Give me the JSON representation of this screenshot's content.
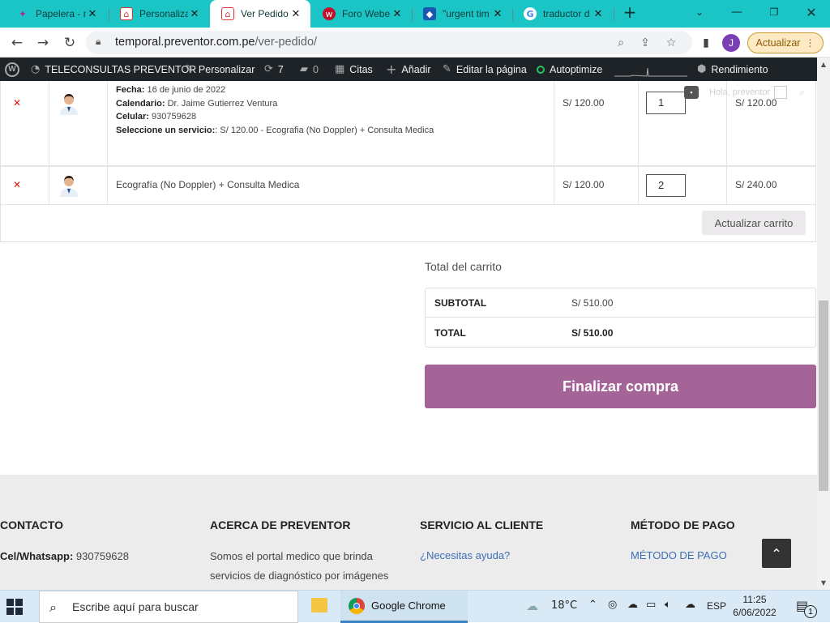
{
  "browser": {
    "tabs": [
      {
        "title": "Papelera - r",
        "fav_color": "#1bc5c5",
        "fav_glyph": "✦",
        "icon": "papelera-favicon"
      },
      {
        "title": "Personaliza",
        "fav_color": "#d33",
        "fav_glyph": "⌂",
        "icon": "preventor-favicon"
      },
      {
        "title": "Ver Pedido",
        "fav_color": "#d33",
        "fav_glyph": "⌂",
        "icon": "preventor-favicon"
      },
      {
        "title": "Foro Webe",
        "fav_color": "#c0102a",
        "fav_glyph": "w",
        "icon": "webempresa-favicon"
      },
      {
        "title": "\"urgent tim",
        "fav_color": "#1a57b0",
        "fav_glyph": "◆",
        "icon": "doc-favicon"
      },
      {
        "title": "traductor d",
        "fav_color": "#4285f4",
        "fav_glyph": "G",
        "icon": "google-favicon"
      }
    ],
    "url_host": "temporal.preventor.com.pe",
    "url_path": "/ver-pedido/",
    "profile_initial": "J",
    "update_label": "Actualizar"
  },
  "wp_admin": {
    "site_name": "TELECONSULTAS PREVENTOR",
    "customize": "Personalizar",
    "updates_count": "7",
    "comments_count": "0",
    "appointments": "Citas",
    "add_new": "Añadir",
    "edit_page": "Editar la página",
    "autoptimize": "Autoptimize",
    "performance": "Rendimiento"
  },
  "header_overlay": {
    "greeting": "Hola, preventor"
  },
  "cart": {
    "items": [
      {
        "meta": [
          {
            "key": "Fecha",
            "value": "16 de junio de 2022"
          },
          {
            "key": "Calendario",
            "value": "Dr. Jaime Gutierrez Ventura"
          },
          {
            "key": "Celular",
            "value": "930759628"
          },
          {
            "key": "Seleccione un servicio:",
            "value": "S/ 120.00 - Ecografia (No Doppler) + Consulta Medica"
          }
        ],
        "price": "S/ 120.00",
        "quantity": "1",
        "subtotal": "S/ 120.00"
      },
      {
        "name": "Ecografía (No Doppler) + Consulta Medica",
        "price": "S/ 120.00",
        "quantity": "2",
        "subtotal": "S/ 240.00"
      }
    ],
    "update_button": "Actualizar carrito"
  },
  "totals": {
    "title": "Total del carrito",
    "subtotal_label": "SUBTOTAL",
    "subtotal_value": "S/ 510.00",
    "total_label": "TOTAL",
    "total_value": "S/ 510.00",
    "checkout_button": "Finalizar compra",
    "checkout_color": "#a46497"
  },
  "footer": {
    "contact": {
      "heading": "CONTACTO",
      "phone_label": "Cel/Whatsapp:",
      "phone_value": "930759628"
    },
    "about": {
      "heading": "ACERCA DE PREVENTOR",
      "text_line1": "Somos el portal medico que brinda",
      "text_line2": "servicios de diagnóstico por imágenes"
    },
    "service": {
      "heading": "SERVICIO AL CLIENTE",
      "help_link": "¿Necesitas ayuda?"
    },
    "payment": {
      "heading": "MÉTODO DE PAGO",
      "link": "MÉTODO DE PAGO"
    }
  },
  "taskbar": {
    "search_placeholder": "Escribe aquí para buscar",
    "chrome_label": "Google Chrome",
    "temperature": "18°C",
    "language": "ESP",
    "time": "11:25",
    "date": "6/06/2022",
    "notification_count": "1"
  }
}
